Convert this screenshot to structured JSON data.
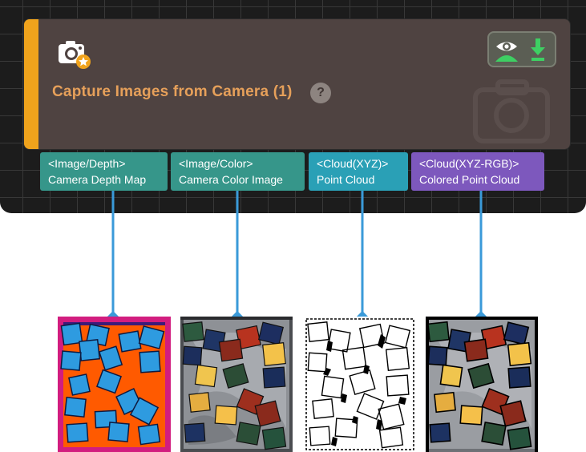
{
  "node": {
    "title": "Capture Images from Camera (1)",
    "help_label": "?",
    "icon": "camera-settings-icon",
    "accent_color": "#f0a31c",
    "actions": [
      "eye-visibility-icon",
      "download-arrow-icon"
    ]
  },
  "ports": [
    {
      "type": "<Image/Depth>",
      "label": "Camera Depth Map",
      "color": "#36968a"
    },
    {
      "type": "<Image/Color>",
      "label": "Camera Color Image",
      "color": "#36968a"
    },
    {
      "type": "<Cloud(XYZ)>",
      "label": "Point Cloud",
      "color": "#2aa0b6"
    },
    {
      "type": "<Cloud(XYZ-RGB)>",
      "label": "Colored Point Cloud",
      "color": "#7d58bd"
    }
  ],
  "connector_color": "#3a9ad9",
  "previews": [
    "depth-map-preview",
    "color-image-preview",
    "point-cloud-preview",
    "colored-point-cloud-preview"
  ]
}
